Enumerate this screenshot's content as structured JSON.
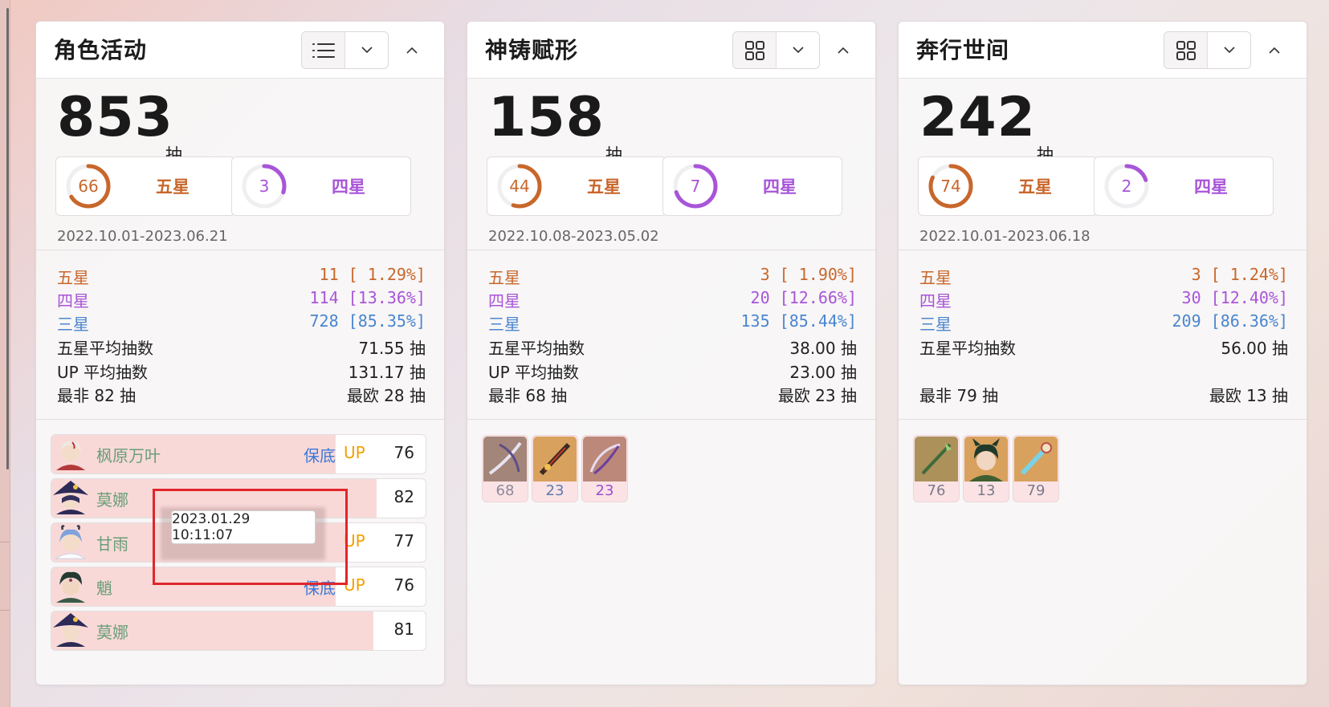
{
  "colors": {
    "five": "#c8672b",
    "four": "#a855d8",
    "three": "#4a86cf",
    "baodi": "#3c78d8",
    "up": "#f2a000",
    "name": "#6a9e78",
    "ring_track": "#efeff1"
  },
  "unit_chou": "抽",
  "panels": [
    {
      "title": "角色活动",
      "view_icon": "list-icon",
      "total": "853",
      "five_ring": {
        "num": "66",
        "label": "五星",
        "fraction": 0.66
      },
      "four_ring": {
        "num": "3",
        "label": "四星",
        "fraction": 0.3
      },
      "date": "2022.10.01-2023.06.21",
      "stats": {
        "five": {
          "label": "五星",
          "value": "11 [ 1.29%]"
        },
        "four": {
          "label": "四星",
          "value": "114 [13.36%]"
        },
        "three": {
          "label": "三星",
          "value": "728 [85.35%]"
        },
        "avg": {
          "label": "五星平均抽数",
          "value": "71.55 抽"
        },
        "up": {
          "label": "UP 平均抽数",
          "value": "131.17 抽"
        },
        "worst": "最非 82 抽",
        "best": "最欧 28 抽"
      },
      "list": [
        {
          "name": "枫原万叶",
          "baodi": "保底",
          "up": "UP",
          "count": "76",
          "fill": 0.76
        },
        {
          "name": "莫娜",
          "baodi": "",
          "up": "",
          "count": "82",
          "fill": 0.87
        },
        {
          "name": "甘雨",
          "baodi": "",
          "up": "UP",
          "count": "77",
          "fill": 0.79
        },
        {
          "name": "魈",
          "baodi": "保底",
          "up": "UP",
          "count": "76",
          "fill": 0.76
        },
        {
          "name": "莫娜",
          "baodi": "",
          "up": "",
          "count": "81",
          "fill": 0.86
        }
      ],
      "tooltip": "2023.01.29 10:11:07"
    },
    {
      "title": "神铸赋形",
      "view_icon": "grid-icon",
      "total": "158",
      "five_ring": {
        "num": "44",
        "label": "五星",
        "fraction": 0.55
      },
      "four_ring": {
        "num": "7",
        "label": "四星",
        "fraction": 0.7
      },
      "date": "2022.10.08-2023.05.02",
      "stats": {
        "five": {
          "label": "五星",
          "value": "3 [ 1.90%]"
        },
        "four": {
          "label": "四星",
          "value": "20 [12.66%]"
        },
        "three": {
          "label": "三星",
          "value": "135 [85.44%]"
        },
        "avg": {
          "label": "五星平均抽数",
          "value": "38.00 抽"
        },
        "up": {
          "label": "UP 平均抽数",
          "value": "23.00 抽"
        },
        "worst": "最非 68 抽",
        "best": "最欧 23 抽"
      },
      "icons": [
        {
          "num": "68",
          "color": "#8a8a9a"
        },
        {
          "num": "23",
          "color": "#5a7bb0"
        },
        {
          "num": "23",
          "color": "#9a4fd0"
        }
      ]
    },
    {
      "title": "奔行世间",
      "view_icon": "grid-icon",
      "total": "242",
      "five_ring": {
        "num": "74",
        "label": "五星",
        "fraction": 0.82
      },
      "four_ring": {
        "num": "2",
        "label": "四星",
        "fraction": 0.2
      },
      "date": "2022.10.01-2023.06.18",
      "stats": {
        "five": {
          "label": "五星",
          "value": "3 [ 1.24%]"
        },
        "four": {
          "label": "四星",
          "value": "30 [12.40%]"
        },
        "three": {
          "label": "三星",
          "value": "209 [86.36%]"
        },
        "avg": {
          "label": "五星平均抽数",
          "value": "56.00 抽"
        },
        "worst": "最非 79 抽",
        "best": "最欧 13 抽"
      },
      "icons": [
        {
          "num": "76",
          "color": "#7a7a8a"
        },
        {
          "num": "13",
          "color": "#7a7a8a"
        },
        {
          "num": "79",
          "color": "#7a7a8a"
        }
      ]
    }
  ]
}
